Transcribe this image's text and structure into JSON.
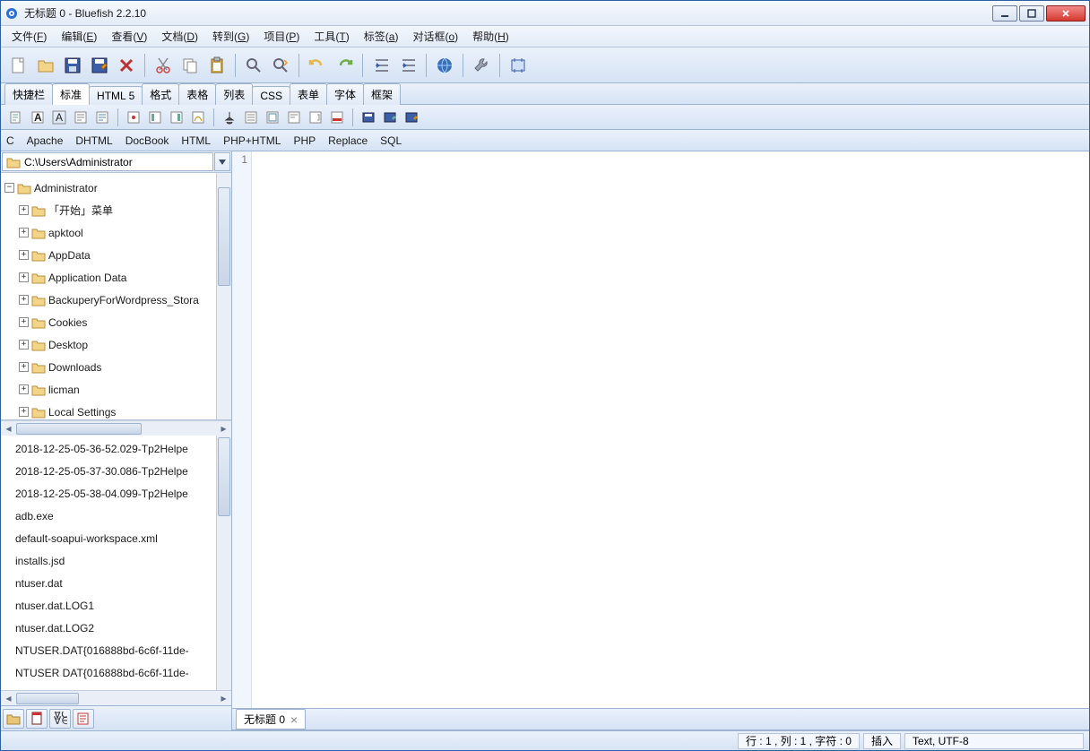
{
  "title": "无标题 0 - Bluefish 2.2.10",
  "menubar": [
    {
      "label": "文件",
      "key": "F"
    },
    {
      "label": "编辑",
      "key": "E"
    },
    {
      "label": "查看",
      "key": "V"
    },
    {
      "label": "文档",
      "key": "D"
    },
    {
      "label": "转到",
      "key": "G"
    },
    {
      "label": "项目",
      "key": "P"
    },
    {
      "label": "工具",
      "key": "T"
    },
    {
      "label": "标签",
      "key": "a"
    },
    {
      "label": "对话框",
      "key": "o"
    },
    {
      "label": "帮助",
      "key": "H"
    }
  ],
  "toolbar": [
    "new",
    "open",
    "save",
    "saveas",
    "close",
    "|",
    "cut",
    "copy",
    "paste",
    "|",
    "find",
    "findrepl",
    "|",
    "undo",
    "redo",
    "|",
    "unindent",
    "indent",
    "|",
    "web",
    "|",
    "tools",
    "|",
    "fullscreen"
  ],
  "tabs": [
    {
      "label": "快捷栏"
    },
    {
      "label": "标准",
      "active": true
    },
    {
      "label": "HTML 5"
    },
    {
      "label": "格式"
    },
    {
      "label": "表格"
    },
    {
      "label": "列表"
    },
    {
      "label": "CSS"
    },
    {
      "label": "表单"
    },
    {
      "label": "字体"
    },
    {
      "label": "框架"
    }
  ],
  "toolbar2_groups": [
    5,
    4,
    6,
    3
  ],
  "langbar": [
    "C",
    "Apache",
    "DHTML",
    "DocBook",
    "HTML",
    "PHP+HTML",
    "PHP",
    "Replace",
    "SQL"
  ],
  "path": "C:\\Users\\Administrator",
  "tree_root": {
    "label": "Administrator",
    "expanded": true
  },
  "tree_children": [
    "「开始」菜单",
    "apktool",
    "AppData",
    "Application Data",
    "BackuperyForWordpress_Stora",
    "Cookies",
    "Desktop",
    "Downloads",
    "licman",
    "Local Settings"
  ],
  "files": [
    "2018-12-25-05-36-52.029-Tp2Helpe",
    "2018-12-25-05-37-30.086-Tp2Helpe",
    "2018-12-25-05-38-04.099-Tp2Helpe",
    "adb.exe",
    "default-soapui-workspace.xml",
    "installs.jsd",
    "ntuser.dat",
    "ntuser.dat.LOG1",
    "ntuser.dat.LOG2",
    "NTUSER.DAT{016888bd-6c6f-11de-",
    "NTUSER DAT{016888bd-6c6f-11de-"
  ],
  "doc_tab": "无标题 0",
  "gutter_line": "1",
  "status": {
    "pos": "行 : 1 , 列 : 1 , 字符 : 0",
    "ins": "插入",
    "enc": "Text, UTF-8"
  }
}
